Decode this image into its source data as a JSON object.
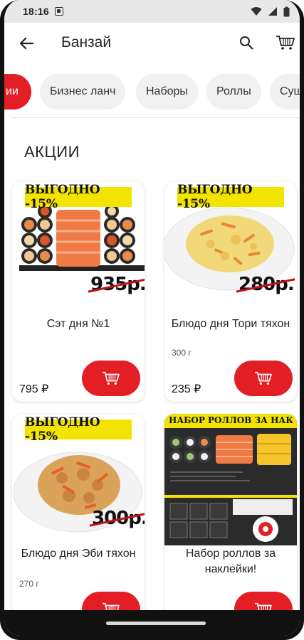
{
  "status_bar": {
    "time": "18:16"
  },
  "app_bar": {
    "title": "Банзай",
    "back_icon": "arrow-left-icon",
    "search_icon": "search-icon",
    "cart_icon": "cart-icon"
  },
  "categories": [
    {
      "label": "ии",
      "active": true
    },
    {
      "label": "Бизнес ланч",
      "active": false
    },
    {
      "label": "Наборы",
      "active": false
    },
    {
      "label": "Роллы",
      "active": false
    },
    {
      "label": "Суш",
      "active": false
    }
  ],
  "section": {
    "title": "АКЦИИ"
  },
  "products": [
    {
      "name": "Сэт дня №1",
      "weight": "",
      "price": "795 ₽",
      "promo_label": "ВЫГОДНО -15%",
      "old_price": "935р."
    },
    {
      "name": "Блюдо дня Тори тяхон",
      "weight": "300 г",
      "price": "235 ₽",
      "promo_label": "ВЫГОДНО -15%",
      "old_price": "280р."
    },
    {
      "name": "Блюдо дня Эби тяхон",
      "weight": "270 г",
      "price": "",
      "promo_label": "ВЫГОДНО -15%",
      "old_price": "300р."
    },
    {
      "name": "Набор роллов за наклейки!",
      "weight": "",
      "price": "",
      "promo_label": "НАБОР РОЛЛОВ ЗА НАКЛЕЙКИ",
      "old_price": ""
    }
  ],
  "colors": {
    "accent": "#e31e24",
    "promo_yellow": "#f2e400"
  }
}
